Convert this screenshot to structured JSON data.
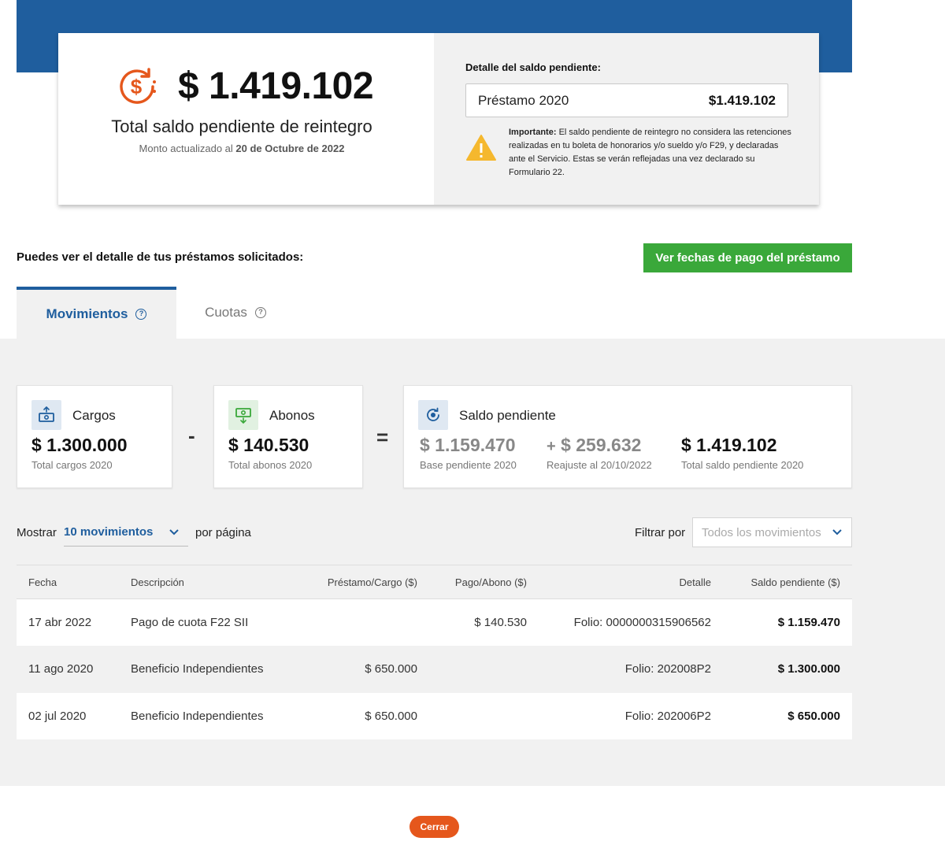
{
  "summary": {
    "amount": "$ 1.419.102",
    "title": "Total saldo pendiente de reintegro",
    "updated_prefix": "Monto actualizado al",
    "updated_date": "20 de Octubre de 2022"
  },
  "detail": {
    "title": "Detalle del saldo pendiente:",
    "item_name": "Préstamo 2020",
    "item_value": "$1.419.102",
    "important_label": "Importante:",
    "important_text": "El saldo pendiente de reintegro no considera las retenciones realizadas en tu boleta de honorarios y/o sueldo y/o F29, y declaradas ante el Servicio. Estas se verán reflejadas una vez declarado su Formulario 22."
  },
  "intro_text": "Puedes ver el detalle de tus préstamos solicitados:",
  "payment_dates_button": "Ver fechas de pago del préstamo",
  "tabs": [
    {
      "label": "Movimientos",
      "active": true
    },
    {
      "label": "Cuotas",
      "active": false
    }
  ],
  "stats": {
    "cargos": {
      "label": "Cargos",
      "value": "$ 1.300.000",
      "caption": "Total cargos 2020"
    },
    "minus": "-",
    "abonos": {
      "label": "Abonos",
      "value": "$ 140.530",
      "caption": "Total abonos 2020"
    },
    "equals": "=",
    "saldo": {
      "label": "Saldo pendiente",
      "base_value": "$ 1.159.470",
      "base_caption": "Base pendiente 2020",
      "plus": "+",
      "reajuste_value": "$ 259.632",
      "reajuste_caption": "Reajuste al 20/10/2022",
      "total_value": "$ 1.419.102",
      "total_caption": "Total saldo pendiente 2020"
    }
  },
  "controls": {
    "show_label": "Mostrar",
    "show_value": "10 movimientos",
    "per_page": "por página",
    "filter_label": "Filtrar por",
    "filter_placeholder": "Todos los movimientos"
  },
  "table": {
    "headers": [
      "Fecha",
      "Descripción",
      "Préstamo/Cargo ($)",
      "Pago/Abono ($)",
      "Detalle",
      "Saldo pendiente ($)"
    ],
    "rows": [
      {
        "fecha": "17 abr 2022",
        "descripcion": "Pago de cuota F22 SII",
        "cargo": "",
        "abono": "$ 140.530",
        "detalle": "Folio: 0000000315906562",
        "saldo": "$ 1.159.470"
      },
      {
        "fecha": "11 ago 2020",
        "descripcion": "Beneficio Independientes",
        "cargo": "$ 650.000",
        "abono": "",
        "detalle": "Folio: 202008P2",
        "saldo": "$ 1.300.000"
      },
      {
        "fecha": "02 jul 2020",
        "descripcion": "Beneficio Independientes",
        "cargo": "$ 650.000",
        "abono": "",
        "detalle": "Folio: 202006P2",
        "saldo": "$ 650.000"
      }
    ]
  },
  "close_button": "Cerrar",
  "colors": {
    "brand_blue": "#1f5e9e",
    "green": "#3aa83a",
    "orange": "#e5571c",
    "warning": "#f5b82e"
  }
}
